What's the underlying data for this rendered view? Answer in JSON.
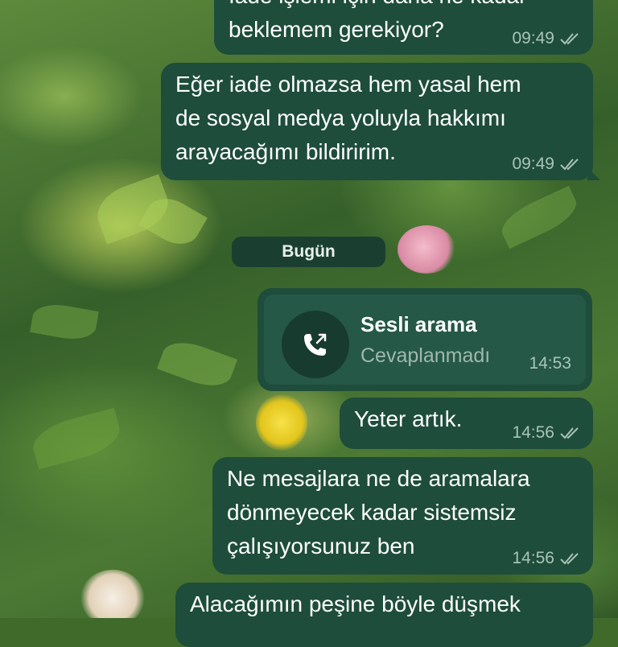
{
  "messages": [
    {
      "lines": "İade işlemi için daha ne kadar\nbeklemem gerekiyor?",
      "time": "09:49",
      "status": "read"
    },
    {
      "lines": "Eğer iade olmazsa hem yasal hem\nde sosyal medya yoluyla hakkımı\narayacağımı bildiririm.",
      "time": "09:49",
      "status": "read"
    },
    {
      "lines": "Yeter artık.",
      "time": "14:56",
      "status": "read"
    },
    {
      "lines": "Ne mesajlara ne de aramalara\ndönmeyecek kadar sistemsiz\nçalışıyorsunuz ben",
      "time": "14:56",
      "status": "read"
    },
    {
      "lines": "Alacağımın peşine böyle düşmek",
      "time": "",
      "status": ""
    }
  ],
  "day_separator": "Bugün",
  "call": {
    "title": "Sesli arama",
    "status": "Cevaplanmadı",
    "time": "14:53",
    "icon": "outgoing-call-icon"
  },
  "colors": {
    "bubble_outgoing": "#1e4d3b",
    "text_meta": "#a9c4b7",
    "day_chip": "#1a3f31"
  }
}
